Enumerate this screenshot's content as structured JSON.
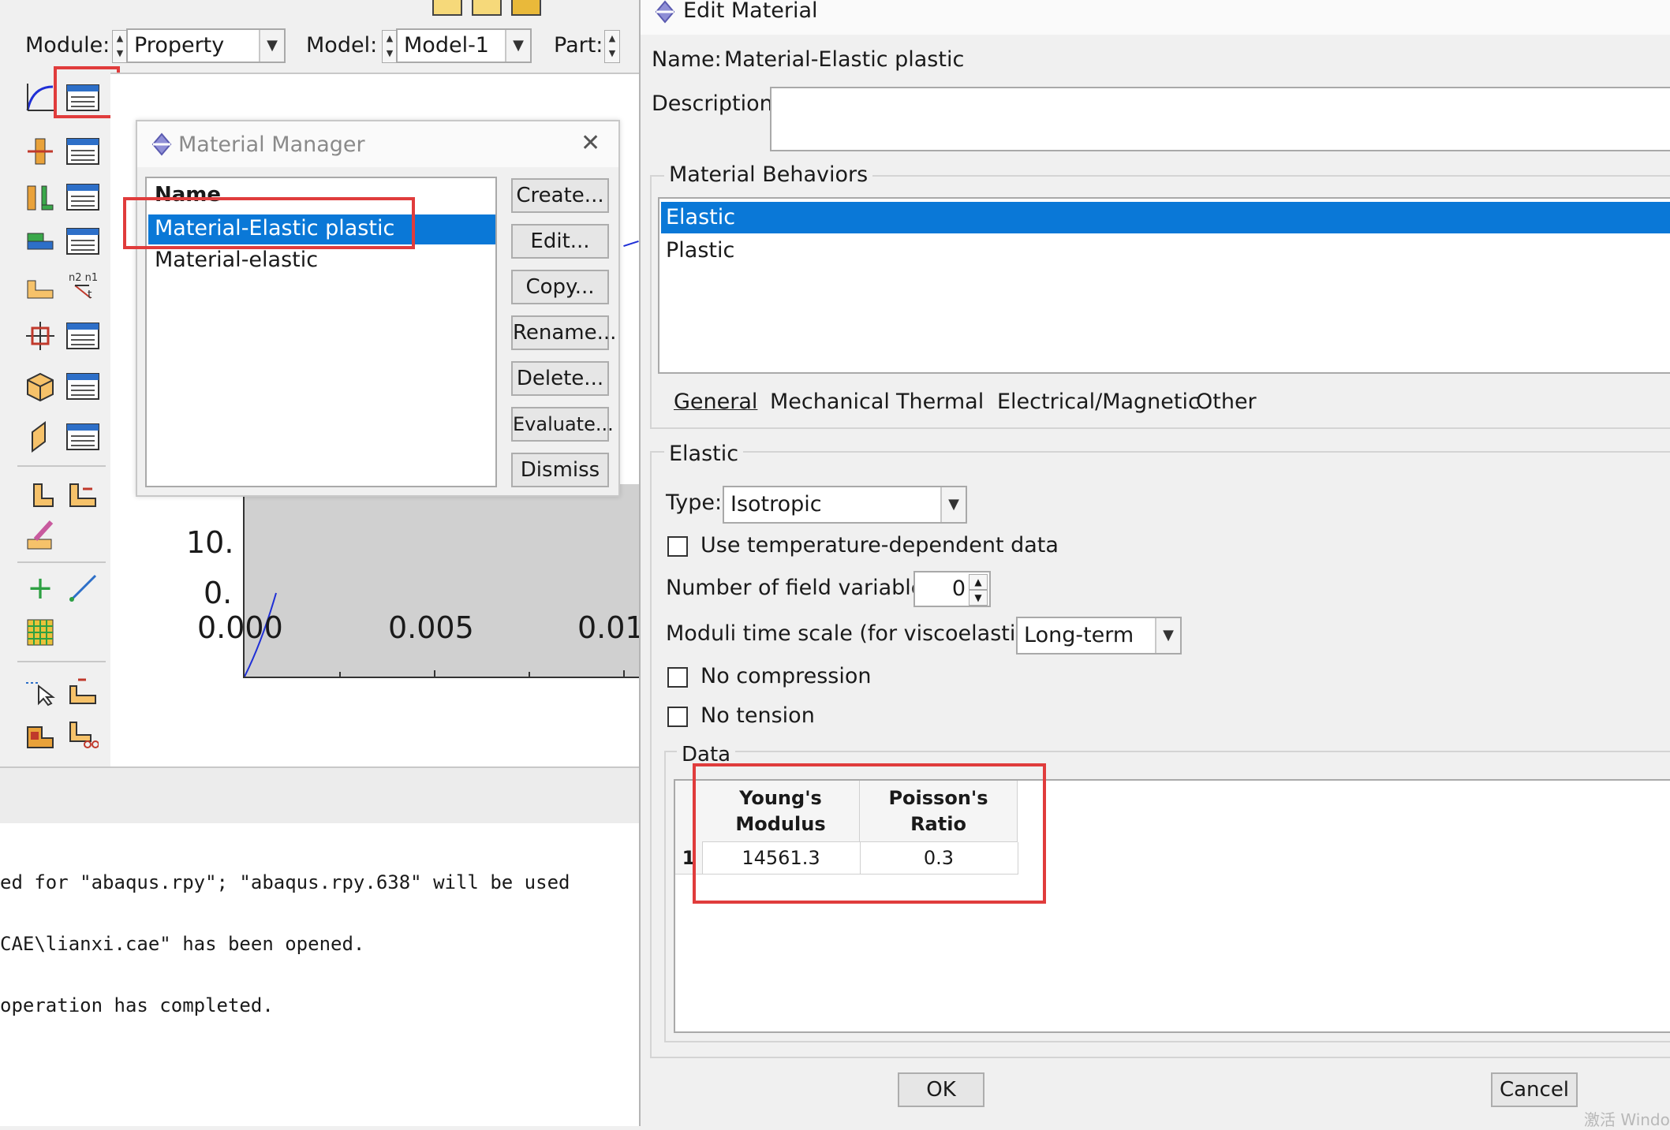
{
  "toolbar": {
    "module_label": "Module:",
    "module_value": "Property",
    "model_label": "Model:",
    "model_value": "Model-1",
    "part_label": "Part:"
  },
  "plot": {
    "y_ticks": [
      "10.",
      "0."
    ],
    "x_ticks": [
      "0.000",
      "0.005",
      "0.01"
    ]
  },
  "material_manager": {
    "title": "Material Manager",
    "column_header": "Name",
    "items": [
      {
        "name": "Material-Elastic plastic",
        "selected": true
      },
      {
        "name": "Material-elastic",
        "selected": false
      }
    ],
    "buttons": [
      "Create...",
      "Edit...",
      "Copy...",
      "Rename...",
      "Delete...",
      "Evaluate...",
      "Dismiss"
    ]
  },
  "console": {
    "lines": [
      "ed for \"abaqus.rpy\"; \"abaqus.rpy.638\" will be used",
      "CAE\\lianxi.cae\" has been opened.",
      "operation has completed."
    ]
  },
  "edit_material": {
    "title": "Edit Material",
    "name_label": "Name:",
    "name_value": "Material-Elastic plastic",
    "description_label": "Description:",
    "description_value": "",
    "behaviors_title": "Material Behaviors",
    "behaviors": [
      {
        "name": "Elastic",
        "selected": true
      },
      {
        "name": "Plastic",
        "selected": false
      }
    ],
    "menu_tabs": [
      "General",
      "Mechanical",
      "Thermal",
      "Electrical/Magnetic",
      "Other"
    ],
    "section_title": "Elastic",
    "type_label": "Type:",
    "type_value": "Isotropic",
    "use_temp_label": "Use temperature-dependent data",
    "field_vars_label": "Number of field variables:",
    "field_vars_value": "0",
    "moduli_label": "Moduli time scale (for viscoelasticity):",
    "moduli_value": "Long-term",
    "no_compression_label": "No compression",
    "no_tension_label": "No tension",
    "data_title": "Data",
    "table": {
      "headers": [
        [
          "Young's",
          "Modulus"
        ],
        [
          "Poisson's",
          "Ratio"
        ]
      ],
      "rows": [
        {
          "index": "1",
          "cells": [
            "14561.3",
            "0.3"
          ]
        }
      ]
    },
    "ok_label": "OK",
    "cancel_label": "Cancel"
  },
  "watermark": "激活 Windo",
  "colors": {
    "selection": "#0a78d7",
    "highlight_box": "#e03c3c",
    "curve": "#1f2fd6"
  }
}
